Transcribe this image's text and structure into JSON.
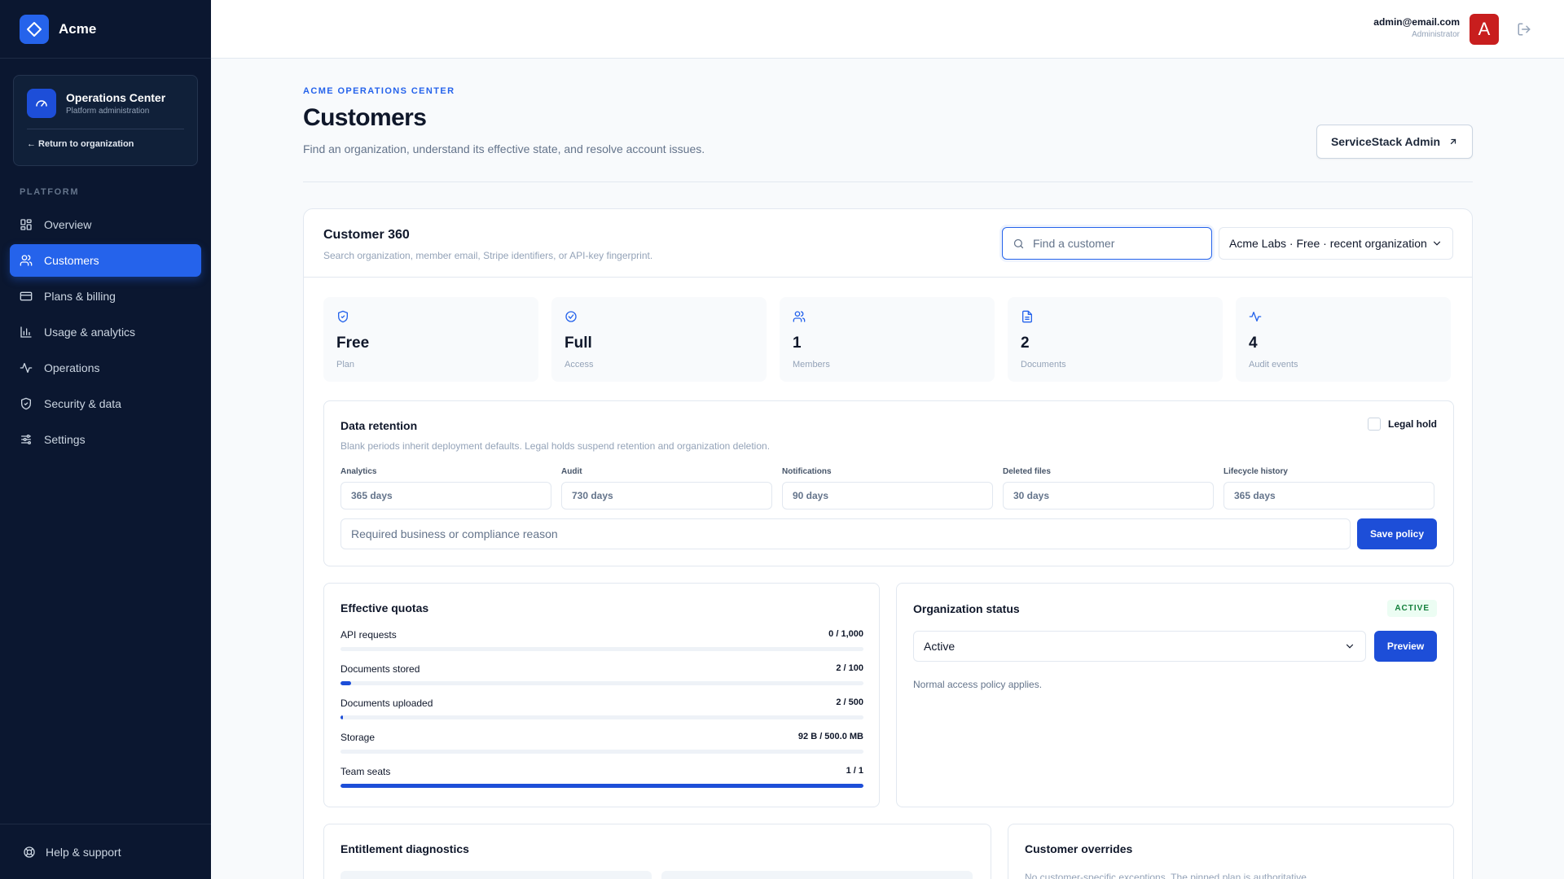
{
  "sidebar": {
    "brand": "Acme",
    "ops": {
      "title": "Operations Center",
      "subtitle": "Platform administration",
      "return_link": "← Return to organization"
    },
    "section_label": "PLATFORM",
    "items": [
      {
        "label": "Overview",
        "icon": "grid-icon"
      },
      {
        "label": "Customers",
        "icon": "users-icon",
        "active": true
      },
      {
        "label": "Plans & billing",
        "icon": "credit-card-icon"
      },
      {
        "label": "Usage & analytics",
        "icon": "bar-chart-icon"
      },
      {
        "label": "Operations",
        "icon": "activity-icon"
      },
      {
        "label": "Security & data",
        "icon": "shield-icon"
      },
      {
        "label": "Settings",
        "icon": "sliders-icon"
      }
    ],
    "help": "Help & support"
  },
  "topbar": {
    "user_email": "admin@email.com",
    "user_role": "Administrator",
    "avatar_letter": "A"
  },
  "header": {
    "eyebrow": "ACME OPERATIONS CENTER",
    "title": "Customers",
    "description": "Find an organization, understand its effective state, and resolve account issues.",
    "admin_button": "ServiceStack Admin"
  },
  "customer360": {
    "title": "Customer 360",
    "subtitle": "Search organization, member email, Stripe identifiers, or API-key fingerprint.",
    "search_placeholder": "Find a customer",
    "selected_org": "Acme Labs · Free · recent organization",
    "stats": [
      {
        "value": "Free",
        "label": "Plan",
        "icon": "shield-check-icon"
      },
      {
        "value": "Full",
        "label": "Access",
        "icon": "check-circle-icon"
      },
      {
        "value": "1",
        "label": "Members",
        "icon": "users-icon"
      },
      {
        "value": "2",
        "label": "Documents",
        "icon": "file-text-icon"
      },
      {
        "value": "4",
        "label": "Audit events",
        "icon": "activity-icon"
      }
    ]
  },
  "retention": {
    "title": "Data retention",
    "subtitle": "Blank periods inherit deployment defaults. Legal holds suspend retention and organization deletion.",
    "legal_hold_label": "Legal hold",
    "fields": [
      {
        "label": "Analytics",
        "placeholder": "365 days"
      },
      {
        "label": "Audit",
        "placeholder": "730 days"
      },
      {
        "label": "Notifications",
        "placeholder": "90 days"
      },
      {
        "label": "Deleted files",
        "placeholder": "30 days"
      },
      {
        "label": "Lifecycle history",
        "placeholder": "365 days"
      }
    ],
    "reason_placeholder": "Required business or compliance reason",
    "save_label": "Save policy"
  },
  "quotas": {
    "title": "Effective quotas",
    "items": [
      {
        "name": "API requests",
        "value": "0 / 1,000",
        "fraction": 0
      },
      {
        "name": "Documents stored",
        "value": "2 / 100",
        "fraction": 0.02
      },
      {
        "name": "Documents uploaded",
        "value": "2 / 500",
        "fraction": 0.004
      },
      {
        "name": "Storage",
        "value": "92 B / 500.0 MB",
        "fraction": 0
      },
      {
        "name": "Team seats",
        "value": "1 / 1",
        "fraction": 1
      }
    ]
  },
  "org_status": {
    "title": "Organization status",
    "badge": "ACTIVE",
    "selected": "Active",
    "preview_label": "Preview",
    "note": "Normal access policy applies."
  },
  "diagnostics": {
    "title": "Entitlement diagnostics"
  },
  "overrides": {
    "title": "Customer overrides",
    "note": "No customer-specific exceptions. The pinned plan is authoritative."
  },
  "colors": {
    "accent": "#2563eb",
    "sidebar_bg": "#0b1730",
    "success": "#15803d",
    "avatar": "#c81e1e"
  }
}
